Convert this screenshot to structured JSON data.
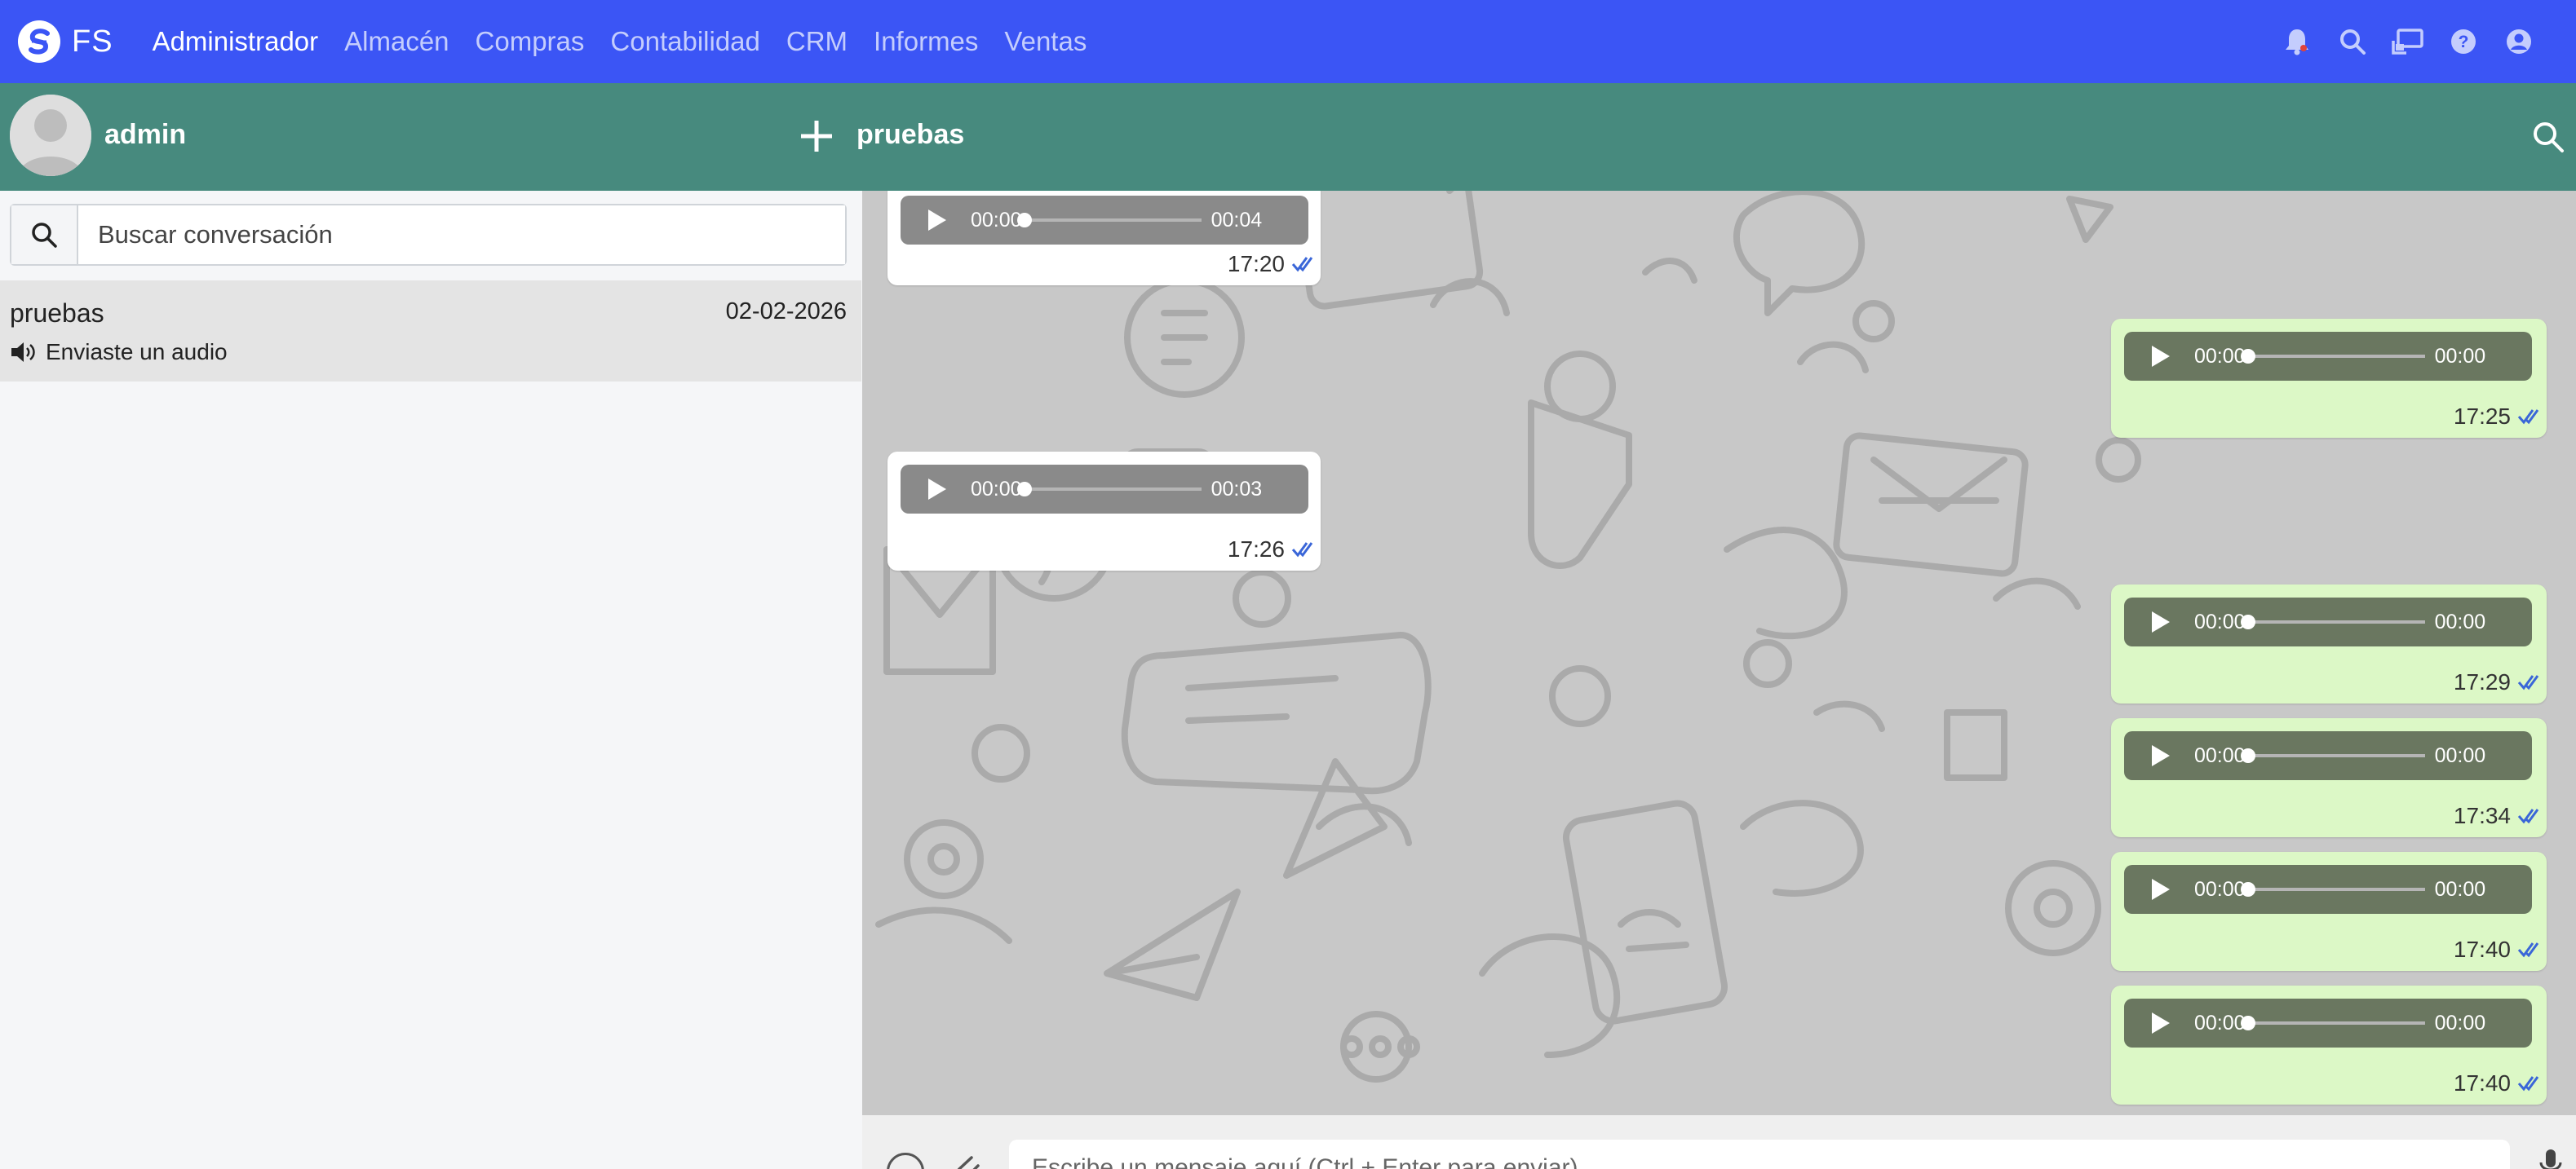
{
  "navbar": {
    "brand": "FS",
    "menu": [
      "Administrador",
      "Almacén",
      "Compras",
      "Contabilidad",
      "CRM",
      "Informes",
      "Ventas"
    ],
    "active_menu": "Administrador",
    "color": "#3b55f5",
    "icons": [
      "bell-icon",
      "search-icon",
      "screen-cast-icon",
      "help-icon",
      "user-circle-icon"
    ]
  },
  "chatbar": {
    "user_name": "admin",
    "chat_title": "pruebas",
    "color": "#478a7e"
  },
  "sidebar": {
    "search_placeholder": "Buscar conversación",
    "conversations": [
      {
        "name": "pruebas",
        "date": "02-02-2026",
        "preview": "Enviaste un audio"
      }
    ]
  },
  "messages": [
    {
      "direction": "in",
      "current": "00:00",
      "duration": "00:04",
      "time": "17:20"
    },
    {
      "direction": "out",
      "current": "00:00",
      "duration": "00:00",
      "time": "17:25"
    },
    {
      "direction": "in",
      "current": "00:00",
      "duration": "00:03",
      "time": "17:26"
    },
    {
      "direction": "out",
      "current": "00:00",
      "duration": "00:00",
      "time": "17:29"
    },
    {
      "direction": "out",
      "current": "00:00",
      "duration": "00:00",
      "time": "17:34"
    },
    {
      "direction": "out",
      "current": "00:00",
      "duration": "00:00",
      "time": "17:40"
    },
    {
      "direction": "out",
      "current": "00:00",
      "duration": "00:00",
      "time": "17:40"
    }
  ],
  "composer": {
    "placeholder": "Escribe un mensaje aquí (Ctrl + Enter para enviar)"
  }
}
